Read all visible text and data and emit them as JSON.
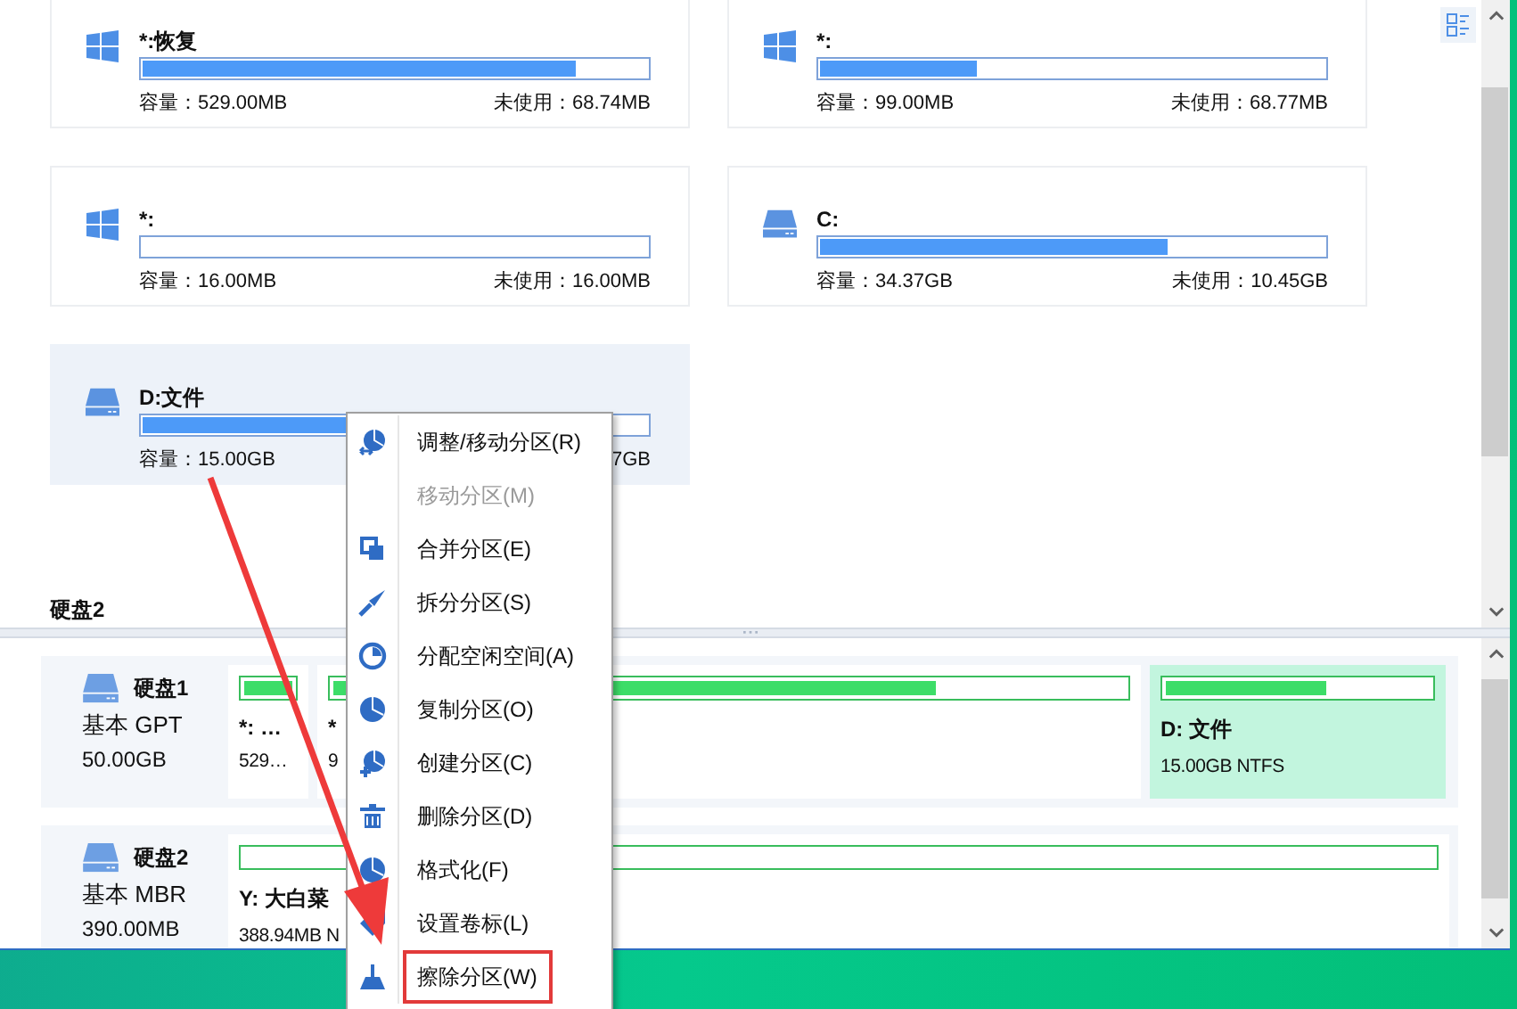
{
  "partitions": [
    {
      "kind": "os",
      "name": "*:恢复",
      "level": 0.86,
      "capacity": "容量：529.00MB",
      "unused": "未使用：68.74MB",
      "selected": false
    },
    {
      "kind": "os",
      "name": "*:",
      "level": 0.31,
      "capacity": "容量：99.00MB",
      "unused": "未使用：68.77MB",
      "selected": false
    },
    {
      "kind": "os",
      "name": "*:",
      "capacity": "容量：16.00MB",
      "unused": "未使用：16.00MB",
      "selected": false
    },
    {
      "kind": "volume",
      "name": "C:",
      "level": 0.69,
      "capacity": "容量：34.37GB",
      "unused": "未使用：10.45GB",
      "selected": false
    },
    {
      "kind": "volume",
      "name": "D:文件",
      "level": 0.45,
      "capacity": "容量：15.00GB",
      "unused": "7GB",
      "selected": true
    }
  ],
  "section_label": "硬盘2",
  "disks": [
    {
      "name": "硬盘1",
      "type": "基本 GPT",
      "size": "50.00GB",
      "parts": [
        {
          "name": "*: …",
          "info": "529…",
          "level": 1,
          "selected": false
        },
        {
          "name": "*",
          "info": "9",
          "level": 1,
          "selected": false
        },
        {
          "level": 0.73,
          "selected": false
        },
        {
          "name": "D: 文件",
          "info": "15.00GB NTFS",
          "level": 0.61,
          "selected": true
        }
      ]
    },
    {
      "name": "硬盘2",
      "type": "基本 MBR",
      "size": "390.00MB",
      "parts": [
        {
          "name": "Y: 大白菜",
          "info": "388.94MB N",
          "selected": false
        }
      ]
    }
  ],
  "context_menu": [
    {
      "label": "调整/移动分区(R)",
      "disabled": false,
      "boxed": false
    },
    {
      "label": "移动分区(M)",
      "disabled": true,
      "boxed": false
    },
    {
      "label": "合并分区(E)",
      "disabled": false,
      "boxed": false
    },
    {
      "label": "拆分分区(S)",
      "disabled": false,
      "boxed": false
    },
    {
      "label": "分配空闲空间(A)",
      "disabled": false,
      "boxed": false
    },
    {
      "label": "复制分区(O)",
      "disabled": false,
      "boxed": false
    },
    {
      "label": "创建分区(C)",
      "disabled": false,
      "boxed": false
    },
    {
      "label": "删除分区(D)",
      "disabled": false,
      "boxed": false
    },
    {
      "label": "格式化(F)",
      "disabled": false,
      "boxed": false
    },
    {
      "label": "设置卷标(L)",
      "disabled": false,
      "boxed": false
    },
    {
      "label": "擦除分区(W)",
      "disabled": false,
      "boxed": true
    }
  ]
}
